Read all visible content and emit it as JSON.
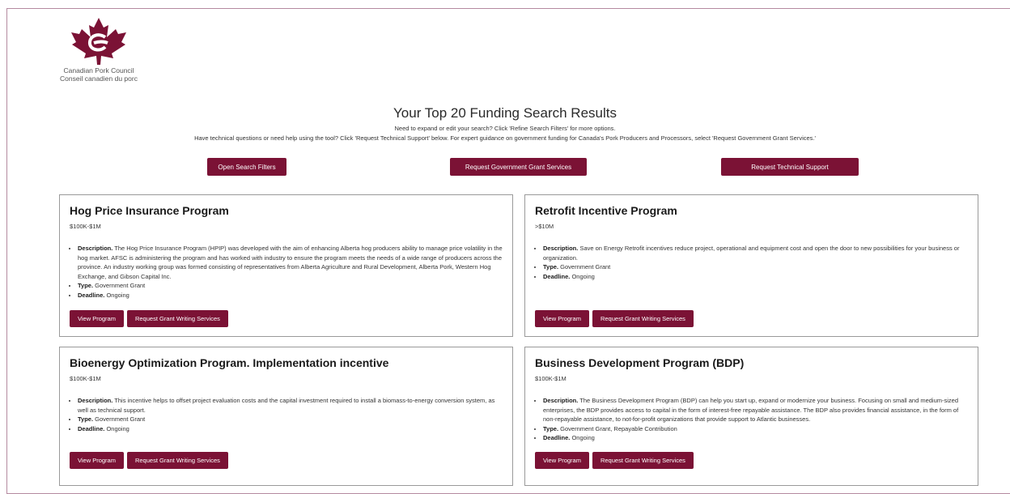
{
  "logo": {
    "line1": "Canadian Pork Council",
    "line2": "Conseil canadien du porc"
  },
  "heading": "Your Top 20 Funding Search Results",
  "subtext1": "Need to expand or edit your search? Click 'Refine Search Filters' for more options.",
  "subtext2": "Have technical questions or need help using the tool? Click 'Request Technical Support' below. For expert guidance on government funding for Canada's Pork Producers and Processors, select 'Request Government Grant Services.'",
  "actions": {
    "open_filters": "Open Search Filters",
    "grant_services": "Request Government Grant Services",
    "tech_support": "Request Technical Support"
  },
  "labels": {
    "description": "Description.",
    "type": "Type.",
    "deadline": "Deadline.",
    "view_program": "View Program",
    "request_writing": "Request Grant Writing Services"
  },
  "programs": [
    {
      "title": "Hog Price Insurance Program",
      "range": "$100K-$1M",
      "description": "The Hog Price Insurance Program (HPIP) was developed with the aim of enhancing Alberta hog producers ability to manage price volatility in the hog market. AFSC is administering the program and has worked with industry to ensure the program meets the needs of a wide range of producers across the province. An industry working group was formed consisting of representatives from Alberta Agriculture and Rural Development, Alberta Pork, Western Hog Exchange, and Gibson Capital Inc.",
      "type": "Government Grant",
      "deadline": "Ongoing"
    },
    {
      "title": "Retrofit Incentive Program",
      "range": ">$10M",
      "description": "Save on Energy Retrofit incentives reduce project, operational and equipment cost and open the door to new possibilities for your business or organization.",
      "type": "Government Grant",
      "deadline": "Ongoing"
    },
    {
      "title": "Bioenergy Optimization Program. Implementation incentive",
      "range": "$100K-$1M",
      "description": "This incentive helps to offset project evaluation costs and the capital investment required to install a biomass-to-energy conversion system, as well as technical support.",
      "type": "Government Grant",
      "deadline": "Ongoing"
    },
    {
      "title": "Business Development Program (BDP)",
      "range": "$100K-$1M",
      "description": "The Business Development Program (BDP) can help you start up, expand or modernize your business. Focusing on small and medium-sized enterprises, the BDP provides access to capital in the form of interest-free repayable assistance. The BDP also provides financial assistance, in the form of non-repayable assistance, to not-for-profit organizations that provide support to Atlantic businesses.",
      "type": "Government Grant, Repayable Contribution",
      "deadline": "Ongoing"
    }
  ],
  "colors": {
    "brand": "#7b1235",
    "frame": "#b58aa0",
    "card_border": "#9a9a9a"
  },
  "icons": {
    "logo": "maple-leaf-icon"
  }
}
